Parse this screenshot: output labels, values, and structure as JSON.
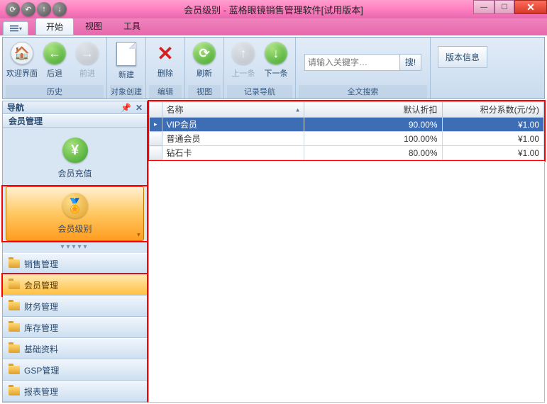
{
  "window": {
    "title": "会员级别 - 蓝格眼镜销售管理软件[试用版本]"
  },
  "titlebar_glyphs": {
    "refresh": "⟳",
    "undo": "↶",
    "up": "↑",
    "down": "↓"
  },
  "ribbon": {
    "tabs": {
      "start": "开始",
      "view": "视图",
      "tools": "工具"
    },
    "groups": {
      "history": {
        "label": "历史",
        "welcome": "欢迎界面",
        "back": "后退",
        "forward": "前进"
      },
      "create": {
        "label": "对象创建",
        "new": "新建"
      },
      "edit": {
        "label": "编辑",
        "delete": "删除"
      },
      "view": {
        "label": "视图",
        "refresh": "刷新"
      },
      "recordnav": {
        "label": "记录导航",
        "prev": "上一条",
        "next": "下一条"
      },
      "search": {
        "label": "全文搜索",
        "placeholder": "请输入关键字…",
        "btn": "搜!"
      },
      "version": "版本信息"
    }
  },
  "sidebar": {
    "title": "导航",
    "section": "会员管理",
    "items": {
      "recharge": "会员充值",
      "level": "会员级别"
    },
    "accordion": {
      "sales": "销售管理",
      "member": "会员管理",
      "finance": "财务管理",
      "stock": "库存管理",
      "basic": "基础资料",
      "gsp": "GSP管理",
      "report": "报表管理"
    }
  },
  "table": {
    "headers": {
      "name": "名称",
      "discount": "默认折扣",
      "points": "积分系数(元/分)"
    },
    "rows": [
      {
        "indicator": "▸",
        "name": "VIP会员",
        "discount": "90.00%",
        "points": "¥1.00"
      },
      {
        "indicator": "",
        "name": "普通会员",
        "discount": "100.00%",
        "points": "¥1.00"
      },
      {
        "indicator": "",
        "name": "钻石卡",
        "discount": "80.00%",
        "points": "¥1.00"
      }
    ]
  }
}
